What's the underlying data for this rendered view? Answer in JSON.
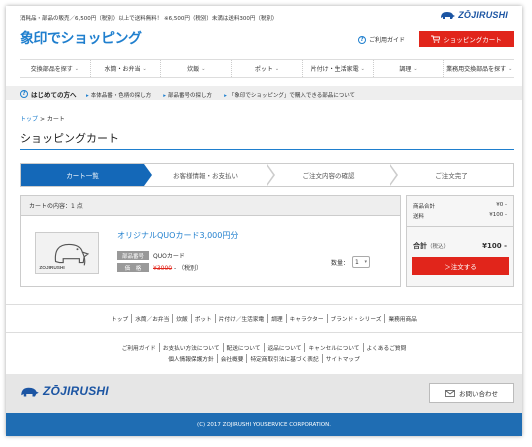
{
  "header": {
    "notice": "消耗品・部品の販売／6,500円（税別）以上で送料無料！ ※6,500円（税別）未満は送料300円（税別）",
    "brand": "ZŌJIRUSHI",
    "shop_logo": "象印でショッピング",
    "guide_link": "ご利用ガイド",
    "cart_button": "ショッピングカート"
  },
  "nav": {
    "items": [
      {
        "label": "交換部品を探す"
      },
      {
        "label": "水筒・お弁当"
      },
      {
        "label": "炊飯"
      },
      {
        "label": "ポット"
      },
      {
        "label": "片付け・生活家電"
      },
      {
        "label": "調理"
      },
      {
        "label": "業務用交換部品を探す"
      }
    ]
  },
  "subbar": {
    "beginner": "はじめての方へ",
    "links": [
      "本体品番・色柄の探し方",
      "部品番号の探し方",
      "「象印でショッピング」で購入できる部品について"
    ]
  },
  "breadcrumb": {
    "home": "トップ",
    "separator": ">",
    "current": "カート"
  },
  "page_title": "ショッピングカート",
  "steps": [
    {
      "label": "カート一覧",
      "active": true
    },
    {
      "label": "お客様情報・お支払い",
      "active": false
    },
    {
      "label": "ご注文内容の確認",
      "active": false
    },
    {
      "label": "ご注文完了",
      "active": false
    }
  ],
  "cart": {
    "count_text": "カートの内容：1 点",
    "item": {
      "name": "オリジナルQUOカード3,000円分",
      "part_label": "部品番号",
      "part_value": "QUOカード",
      "price_label": "価　格",
      "price_old": "¥3000",
      "price_sep": " - ",
      "price_note": "（税別）",
      "qty_label": "数量：",
      "qty_value": "1"
    },
    "image_text": "ZOJIRUSHI"
  },
  "summary": {
    "subtotal_label": "商品合計",
    "subtotal_value": "¥0 -",
    "shipping_label": "送料",
    "shipping_value": "¥100 -",
    "total_label": "合計",
    "total_tax": "（税込）",
    "total_value": "¥100 -",
    "order_button": "＞注文する"
  },
  "footer": {
    "links1": [
      "トップ",
      "水筒／お弁当",
      "炊飯",
      "ポット",
      "片付け／生活家電",
      "調理",
      "キャラクター",
      "ブランド・シリーズ",
      "業務用商品"
    ],
    "links2": [
      "ご利用ガイド",
      "お支払い方法について",
      "配送について",
      "返品について",
      "キャンセルについて",
      "よくあるご質問"
    ],
    "links3": [
      "個人情報保護方針",
      "会社概要",
      "特定商取引法に基づく表記",
      "サイトマップ"
    ],
    "brand": "ZŌJIRUSHI",
    "contact": "お問い合わせ",
    "copyright": "(C) 2017 ZOJIRUSHI YOUSERVICE CORPORATION."
  },
  "colors": {
    "brand_blue": "#1f7fce",
    "accent_red": "#e1251b",
    "step_active": "#1468b8",
    "footer_blue": "#1f6db3"
  }
}
